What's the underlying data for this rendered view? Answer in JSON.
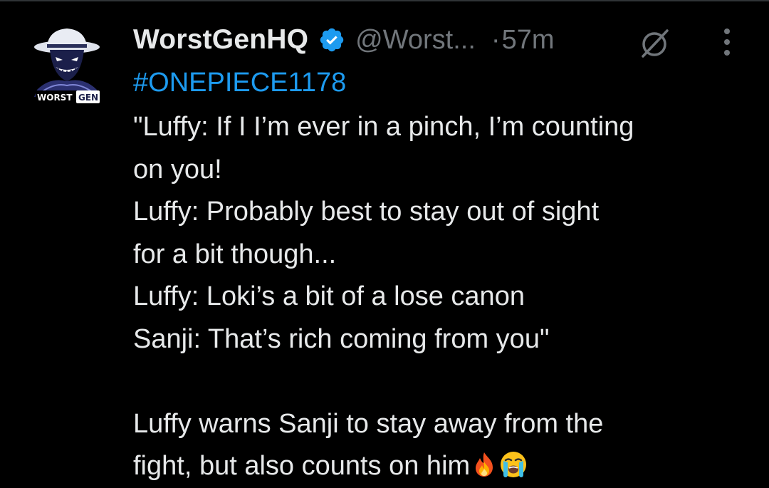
{
  "tweet": {
    "display_name": "WorstGenHQ",
    "handle": "@Worst...",
    "separator": "·",
    "time": "57m",
    "verified": true,
    "avatar_text": {
      "worst": "WORST",
      "gen": "GEN"
    },
    "hashtag": "#ONEPIECE1178",
    "lines": [
      "\"Luffy: If I I’m ever in a pinch, I’m counting",
      "on you!",
      "Luffy: Probably best to stay out of sight",
      "for a bit though...",
      "Luffy: Loki’s a bit of a lose canon",
      "Sanji: That’s rich coming from you\"",
      "",
      "Luffy warns Sanji to stay away from the",
      "fight, but also counts on him"
    ],
    "emoji_icons": [
      "fire-emoji",
      "loudly-crying-face-emoji"
    ]
  },
  "icons": {
    "verified": "verified-badge-icon",
    "grok": "grok-icon",
    "more": "more-vertical-icon"
  },
  "colors": {
    "background": "#000000",
    "text": "#e7e9ea",
    "secondary": "#71767b",
    "link": "#1d9bf0",
    "verified": "#1d9bf0"
  }
}
